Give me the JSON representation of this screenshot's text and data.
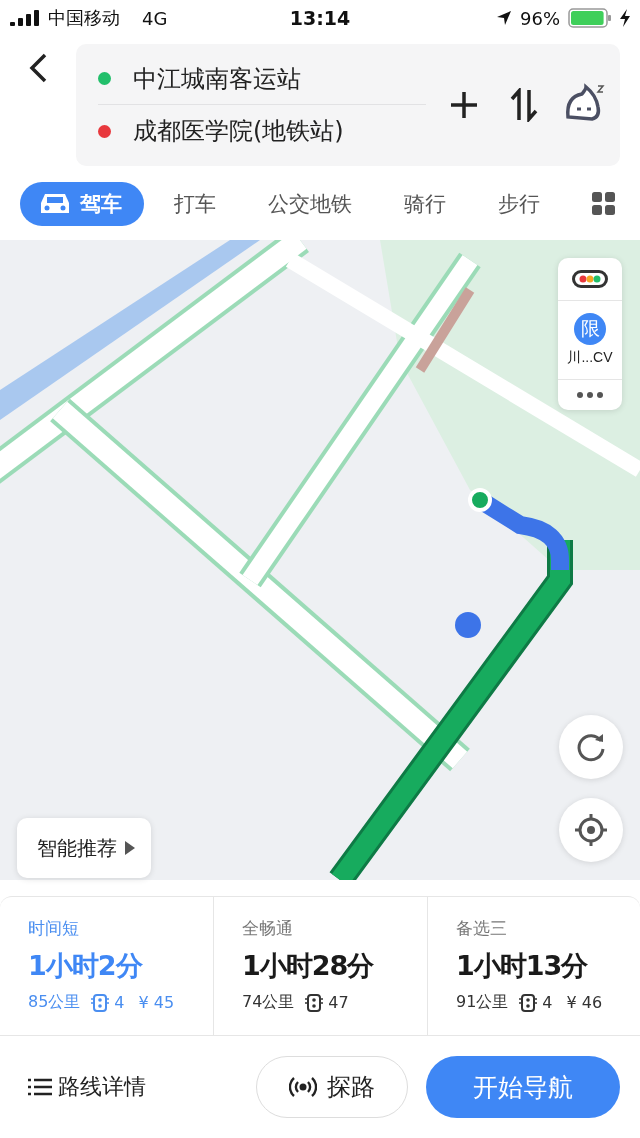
{
  "status_bar": {
    "carrier": "中国移动",
    "network": "4G",
    "time": "13:14",
    "battery": "96%"
  },
  "route": {
    "start": "中江城南客运站",
    "end": "成都医学院(地铁站)"
  },
  "modes": [
    {
      "label": "驾车",
      "selected": true
    },
    {
      "label": "打车",
      "selected": false
    },
    {
      "label": "公交地铁",
      "selected": false
    },
    {
      "label": "骑行",
      "selected": false
    },
    {
      "label": "步行",
      "selected": false
    }
  ],
  "map_controls": {
    "restriction_badge": "限",
    "plate": "川...CV",
    "smart_recommend": "智能推荐"
  },
  "routes": [
    {
      "tag": "时间短",
      "duration": "1小时2分",
      "distance": "85公里",
      "lights": "4",
      "cost": "¥ 45",
      "selected": true
    },
    {
      "tag": "全畅通",
      "duration": "1小时28分",
      "distance": "74公里",
      "lights": "47",
      "selected": false
    },
    {
      "tag": "备选三",
      "duration": "1小时13分",
      "distance": "91公里",
      "lights": "4",
      "cost": "¥ 46",
      "selected": false
    }
  ],
  "actions": {
    "details": "路线详情",
    "explore": "探路",
    "navigate": "开始导航"
  }
}
